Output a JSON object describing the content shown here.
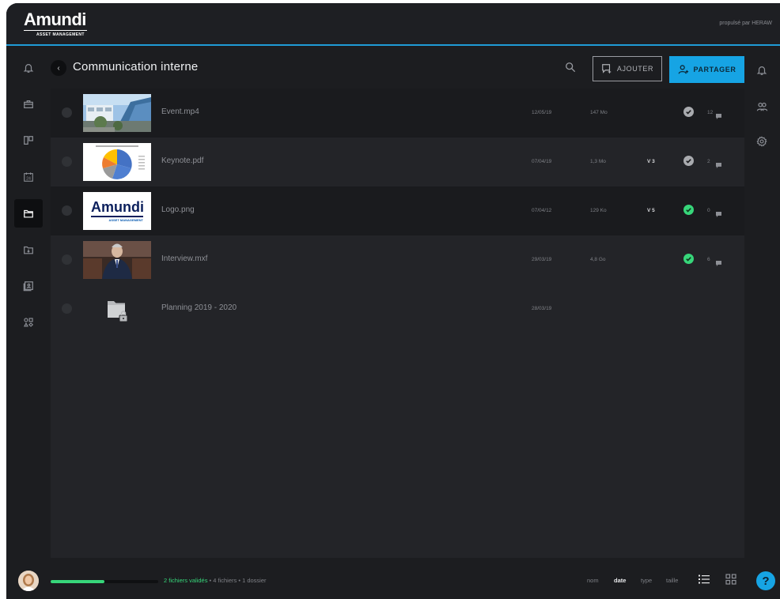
{
  "brand": {
    "logo_word": "Amundi",
    "logo_sub": "ASSET MANAGEMENT",
    "powered_by": "propulsé par HERAW",
    "accent": "#16a4e4",
    "valid_color": "#37d67a"
  },
  "left_nav": [
    "bell-icon",
    "briefcase-icon",
    "kanban-icon",
    "calendar-icon",
    "folder-icon",
    "folder-download-icon",
    "contacts-icon",
    "apps-icon"
  ],
  "left_nav_active": "folder-icon",
  "left_nav_calendar_day": "24",
  "right_nav": [
    "bell-icon",
    "users-icon",
    "settings-icon"
  ],
  "header": {
    "title": "Communication interne",
    "add_label": "AJOUTER",
    "share_label": "PARTAGER"
  },
  "files": [
    {
      "name": "Event.mp4",
      "date": "12/05/19",
      "size": "147 Mo",
      "version": "",
      "status": "grey",
      "comments": "12",
      "thumb": "photo-building"
    },
    {
      "name": "Keynote.pdf",
      "date": "07/04/19",
      "size": "1,3 Mo",
      "version": "V 3",
      "status": "grey",
      "comments": "2",
      "thumb": "pie-chart"
    },
    {
      "name": "Logo.png",
      "date": "07/04/12",
      "size": "129 Ko",
      "version": "V 5",
      "status": "green",
      "comments": "0",
      "thumb": "logo"
    },
    {
      "name": "Interview.mxf",
      "date": "29/03/19",
      "size": "4,8 Go",
      "version": "",
      "status": "green",
      "comments": "6",
      "thumb": "photo-person"
    },
    {
      "name": "Planning 2019 - 2020",
      "date": "28/03/19",
      "size": "",
      "version": "",
      "status": "",
      "comments": "",
      "thumb": "locked-folder"
    }
  ],
  "footer": {
    "progress_fraction": 0.5,
    "validated": "2 fichiers validés",
    "sep1": " • ",
    "files_count": "4 fichiers",
    "sep2": " • ",
    "folders_count": "1 dossier",
    "sort_options": [
      "nom",
      "date",
      "type",
      "taille"
    ],
    "sort_active": "date",
    "help": "?"
  }
}
